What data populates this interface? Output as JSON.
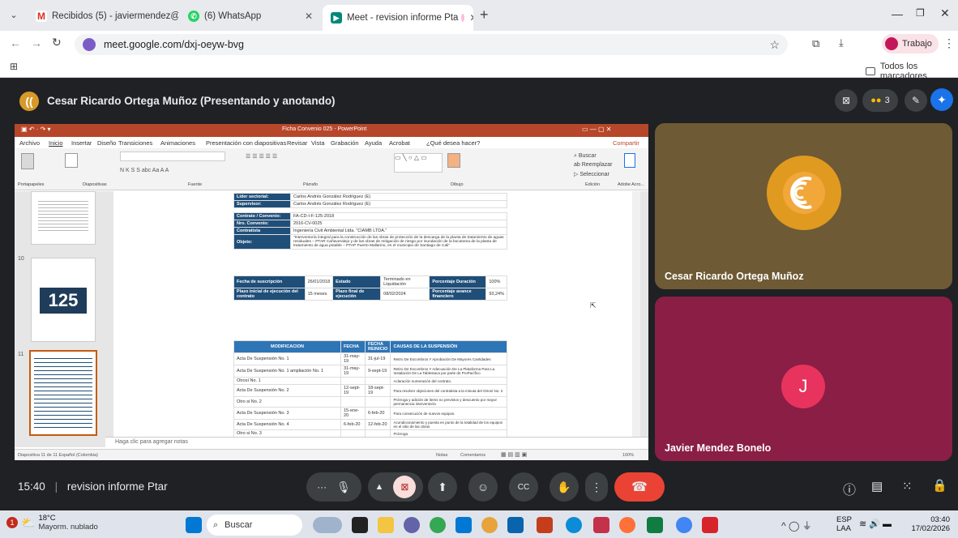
{
  "browser": {
    "tabs": [
      {
        "label": "Recibidos (5) - javiermendez@",
        "icon": "gmail-icon",
        "active": false
      },
      {
        "label": "(6) WhatsApp",
        "icon": "whatsapp-icon",
        "active": false
      },
      {
        "label": "Meet - revision informe Pta",
        "icon": "meet-icon",
        "active": true
      }
    ],
    "url": "meet.google.com/dxj-oeyw-bvg",
    "profile": "Trabajo",
    "bookmarks_label": "Todos los marcadores"
  },
  "meet": {
    "presenter": "Cesar Ricardo Ortega Muñoz (Presentando y anotando)",
    "participants_count": "3",
    "time": "15:40",
    "separator": "|",
    "meeting_title": "revision informe Ptar",
    "participants": [
      {
        "name": "Cesar Ricardo Ortega Muñoz",
        "avatar": "cesar-avatar"
      },
      {
        "name": "Javier Mendez Bonelo",
        "initial": "J"
      }
    ]
  },
  "ppt": {
    "title": "Ficha Convenio 025 - PowerPoint",
    "menu": [
      "Archivo",
      "Inicio",
      "Insertar",
      "Diseño",
      "Transiciones",
      "Animaciones",
      "Presentación con diapositivas",
      "Revisar",
      "Vista",
      "Grabación",
      "Ayuda",
      "Acrobat",
      "¿Qué desea hacer?"
    ],
    "share": "Compartir",
    "groups": [
      "Portapapeles",
      "Diapositivas",
      "Fuente",
      "Párrafo",
      "Dibujo",
      "Edición",
      "Adobe Acro..."
    ],
    "slide_numbers": [
      "10",
      "11"
    ],
    "thumb_text": "125",
    "notes_placeholder": "Haga clic para agregar notas",
    "status_left": "Diapositiva 11 de 11   Español (Colombia)",
    "status_notes": "Notas",
    "status_comments": "Comentarios",
    "zoom": "100%",
    "doc": {
      "rows": [
        {
          "label": "Líder sectorial:",
          "value": "Carlos Andrés González Rodríguez (E)"
        },
        {
          "label": "Supervisor:",
          "value": "Carlos Andrés González Rodríguez (E)"
        },
        {
          "label": "Contrato / Convenio:",
          "value": "FA-CD-I-F-125-2018"
        },
        {
          "label": "Nro. Convenio:",
          "value": "2016-CV-0025"
        },
        {
          "label": "Contratista",
          "value": "Ingeniería Civil Ambiental Ltda. \"CIAMB LTDA.\""
        },
        {
          "label": "Objeto:",
          "value": "\"Interventoría integral para la construcción de las obras de protección de la descarga de la planta de tratamiento de aguas residuales – PTAR Cañaveralejo y de las obras de mitigación de riesgo por inundación de la bocatoma de la planta de tratamiento de agua potable – PTAP Puerto Mallarino, en el municipio de Santiago de Cali\""
        }
      ],
      "dates": {
        "l1": "Fecha de suscripción",
        "v1": "26/01/2018",
        "l2": "Estado",
        "v2": "Terminado en Liquidación",
        "l3": "Porcentaje Duración",
        "v3": "100%",
        "l4": "Plazo inicial de ejecución del contrato",
        "v4": "15 meses",
        "l5": "Plazo final de ejecución",
        "v5": "08/02/2024",
        "l6": "Porcentaje avance financiero",
        "v6": "93,24%"
      },
      "mods_headers": [
        "MODIFICACION",
        "FECHA",
        "FECHA REINICIO",
        "CAUSAS DE LA SUSPENSIÓN"
      ],
      "mods": [
        [
          "Acta De Suspensión No. 1",
          "31-may-19",
          "31-jul-19",
          "Retiro De Escombros Y Aprobación De Mayores Cantidades"
        ],
        [
          "Acta De Suspensión No. 1 ampliación No. 1",
          "31-may-19",
          "9-sept-19",
          "Retiro De Escombros Y Adecuación De La Plataforma Para La Instalación De La Tablestaca por parte de ProPacífico"
        ],
        [
          "Otrosí No. 1",
          "",
          "",
          "Aclaración numeración del contrato."
        ],
        [
          "Acta De Suspensión No. 2",
          "12-sept-19",
          "18-sept-19",
          "Para resolver objeciones del contratista a la minuta del Otrosí No. 2"
        ],
        [
          "Otro si No. 2",
          "",
          "",
          "Prórroga y adición de ítems no previstos y descuento por mayor permanencia interventoría"
        ],
        [
          "Acta De Suspensión No. 3",
          "15-ene-20",
          "6-feb-20",
          "Para consecución de nuevos equipos."
        ],
        [
          "Acta De Suspensión No. 4",
          "6-feb-20",
          "12-feb-20",
          "Acondicionamiento y puesta en punto de la totalidad de los equipos en el sitio de las obras"
        ],
        [
          "Otro si No. 3",
          "",
          "",
          "Prórroga"
        ]
      ]
    }
  },
  "taskbar": {
    "weather_temp": "18°C",
    "weather_desc": "Mayorm. nublado",
    "search": "Buscar",
    "lang1": "ESP",
    "lang2": "LAA",
    "clock_time": "03:40",
    "clock_date": "17/02/2026",
    "notif": "1"
  },
  "colors": {
    "meet_bg": "#202124",
    "tile_gold": "#6e5a34",
    "tile_pink": "#8a1e44",
    "accent": "#1a73e8",
    "end_call": "#ea4335"
  }
}
